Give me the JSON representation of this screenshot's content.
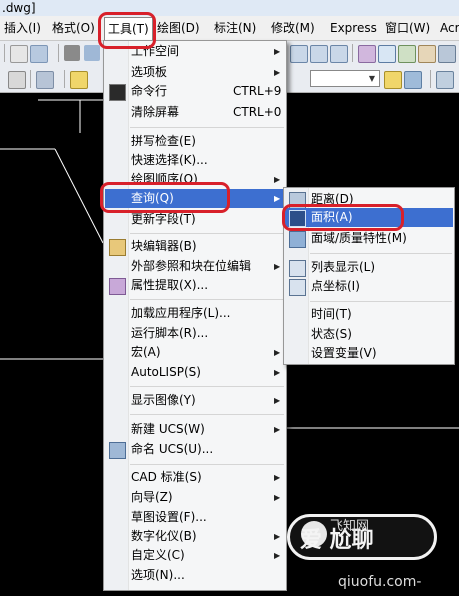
{
  "window": {
    "title_fragment": ".dwg]"
  },
  "menubar": {
    "items": [
      {
        "label": "插入(I)"
      },
      {
        "label": "格式(O)"
      },
      {
        "label": "工具(T)"
      },
      {
        "label": "绘图(D)"
      },
      {
        "label": "标注(N)"
      },
      {
        "label": "修改(M)"
      },
      {
        "label": "Express"
      },
      {
        "label": "窗口(W)"
      },
      {
        "label": "Acr"
      }
    ]
  },
  "tools_menu": {
    "items": [
      {
        "label": "工作空间",
        "submenu": true
      },
      {
        "label": "选项板",
        "submenu": true
      },
      {
        "label": "命令行",
        "shortcut": "CTRL+9",
        "icon": "command-line-icon"
      },
      {
        "label": "清除屏幕",
        "shortcut": "CTRL+0"
      },
      {
        "label": "拼写检查(E)"
      },
      {
        "label": "快速选择(K)..."
      },
      {
        "label": "绘图顺序(O)",
        "submenu": true
      },
      {
        "label": "查询(Q)",
        "submenu": true,
        "highlighted": true
      },
      {
        "label": "更新字段(T)"
      },
      {
        "label": "块编辑器(B)",
        "icon": "block-editor-icon"
      },
      {
        "label": "外部参照和块在位编辑",
        "submenu": true
      },
      {
        "label": "属性提取(X)...",
        "icon": "attribute-extract-icon"
      },
      {
        "label": "加载应用程序(L)..."
      },
      {
        "label": "运行脚本(R)..."
      },
      {
        "label": "宏(A)",
        "submenu": true
      },
      {
        "label": "AutoLISP(S)",
        "submenu": true
      },
      {
        "label": "显示图像(Y)",
        "submenu": true
      },
      {
        "label": "新建 UCS(W)",
        "submenu": true
      },
      {
        "label": "命名 UCS(U)...",
        "icon": "ucs-icon"
      },
      {
        "label": "CAD 标准(S)",
        "submenu": true
      },
      {
        "label": "向导(Z)",
        "submenu": true
      },
      {
        "label": "草图设置(F)..."
      },
      {
        "label": "数字化仪(B)",
        "submenu": true
      },
      {
        "label": "自定义(C)",
        "submenu": true
      },
      {
        "label": "选项(N)..."
      }
    ]
  },
  "query_submenu": {
    "items": [
      {
        "label": "距离(D)",
        "icon": "distance-icon"
      },
      {
        "label": "面积(A)",
        "icon": "area-icon",
        "highlighted": true
      },
      {
        "label": "面域/质量特性(M)",
        "icon": "region-mass-icon"
      },
      {
        "label": "列表显示(L)",
        "icon": "list-icon"
      },
      {
        "label": "点坐标(I)",
        "icon": "point-coord-icon"
      },
      {
        "label": "时间(T)"
      },
      {
        "label": "状态(S)"
      },
      {
        "label": "设置变量(V)"
      }
    ]
  },
  "watermark": {
    "brand": "爱 尬聊",
    "url": "qiuofu.com-",
    "side_text": "飞知网"
  },
  "colors": {
    "highlight": "#3d6fd0",
    "annotation_ring": "#d8202a",
    "menu_bg": "#f5f6f7"
  }
}
